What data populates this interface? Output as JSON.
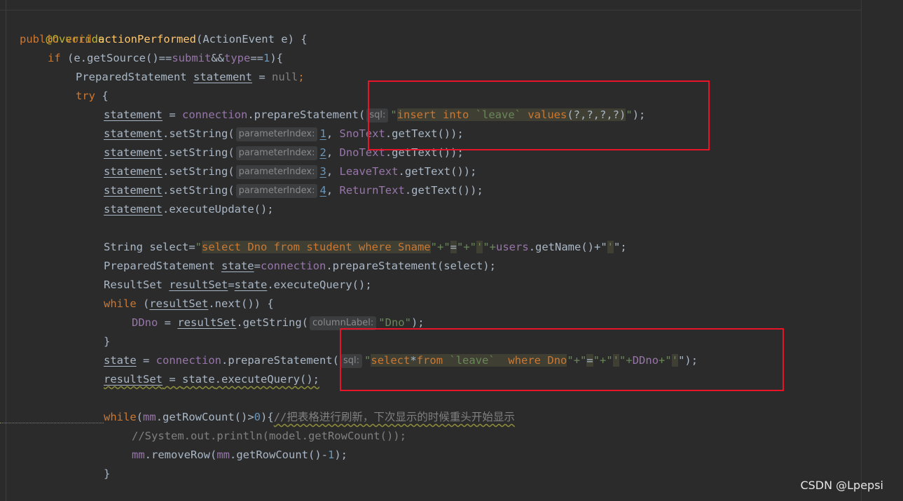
{
  "code": {
    "annotation": "@Override",
    "signature": {
      "modifiers": "public void",
      "method": "actionPerformed",
      "params": "(ActionEvent e) {"
    },
    "if_line": {
      "kw": "if",
      "pre": "(e.getSource()==",
      "f1": "submit",
      "mid": "&&",
      "f2": "type",
      "eq": "==",
      "num": "1",
      "post": "){"
    },
    "decl_statement": {
      "type": "PreparedStatement",
      "var": "statement",
      "eq": " = ",
      "null": "null",
      "semi": ";"
    },
    "try_line": {
      "kw": "try",
      "post": " {"
    },
    "prepare_insert": {
      "var": "statement",
      "eq": " = ",
      "obj": "connection",
      "call": ".prepareStatement(",
      "hint": "sql:",
      "q_open": "\"",
      "sql_kw": "insert into",
      "sql_space": " ",
      "sql_table": "`leave`",
      "sql_kw2": " values",
      "sql_args": "(?,?,?,?)",
      "q_close": "\"",
      "post": ");"
    },
    "set_strings": [
      {
        "var": "statement",
        "call": ".setString(",
        "hint": "parameterIndex:",
        "idx": "1",
        "comma": ", ",
        "obj": "SnoText",
        "rest": ".getText());"
      },
      {
        "var": "statement",
        "call": ".setString(",
        "hint": "parameterIndex:",
        "idx": "2",
        "comma": ", ",
        "obj": "DnoText",
        "rest": ".getText());"
      },
      {
        "var": "statement",
        "call": ".setString(",
        "hint": "parameterIndex:",
        "idx": "3",
        "comma": ", ",
        "obj": "LeaveText",
        "rest": ".getText());"
      },
      {
        "var": "statement",
        "call": ".setString(",
        "hint": "parameterIndex:",
        "idx": "4",
        "comma": ", ",
        "obj": "ReturnText",
        "rest": ".getText());"
      }
    ],
    "execute_update": {
      "var": "statement",
      "call": ".executeUpdate();"
    },
    "select_string": {
      "type": "String select=",
      "q_open": "\"",
      "s1": "select ",
      "s2": "Dno",
      "s3": " from ",
      "s4": "student",
      "s5": " where ",
      "s6": "Sname",
      "concat1": "\"+\"",
      "eq_lit": "=",
      "concat2": "\"+\"",
      "quote_lit": "'",
      "concat3": "\"+",
      "obj": "users",
      "call": ".getName()+\"",
      "quote_lit2": "'",
      "post": "\";"
    },
    "prepare_state": {
      "type": "PreparedStatement ",
      "var": "state",
      "eq": "=",
      "obj": "connection",
      "call": ".prepareStatement(select);"
    },
    "result_set": {
      "type": "ResultSet ",
      "var": "resultSet",
      "eq": "=",
      "obj": "state",
      "call": ".executeQuery();"
    },
    "while_next": {
      "kw": "while",
      "pre": " (",
      "var": "resultSet",
      "post": ".next()) {"
    },
    "ddno_assign": {
      "var": "DDno",
      "eq": " = ",
      "obj": "resultSet",
      "call": ".getString(",
      "hint": "columnLabel:",
      "str": "\"Dno\"",
      "post": ");"
    },
    "brace_close": "}",
    "prepare_select": {
      "var": "state",
      "eq": " = ",
      "obj": "connection",
      "call": ".prepareStatement(",
      "hint": "sql:",
      "q_open": "\"",
      "s1": "select",
      "s2": "*",
      "s3": "from",
      "s4": " `leave`  ",
      "s5": "where",
      "s6": " Dno",
      "concat1": "\"+\"",
      "eq_lit": "=",
      "concat2": "\"+\"",
      "quote_lit": "'",
      "concat3": "\"+",
      "var2": "DDno",
      "concat4": "+\"",
      "quote_lit2": "'",
      "post": "\");"
    },
    "execute_query": {
      "var": "resultSet",
      "eq": " = ",
      "obj": "state",
      "call": ".executeQuery();"
    },
    "while_rowcount": {
      "kw": "while",
      "pre": "(",
      "obj": "mm",
      "call": ".getRowCount()>",
      "num": "0",
      "post": "){",
      "comment": "//把表格进行刷新，下次显示的时候重头开始显示"
    },
    "comment_print": "//System.out.println(model.getRowCount());",
    "remove_row": {
      "obj": "mm",
      "call": ".removeRow(",
      "obj2": "mm",
      "call2": ".getRowCount()-",
      "num": "1",
      "post": ");"
    },
    "brace_close2": "}"
  },
  "watermark": "CSDN @Lpepsi",
  "colors": {
    "background": "#2b2b2b",
    "keyword": "#cc7832",
    "method": "#ffc66d",
    "field": "#9876aa",
    "string": "#6a8759",
    "number": "#6897bb",
    "comment": "#808080",
    "annotation": "#bbb529",
    "highlight_box": "#e8142a"
  }
}
